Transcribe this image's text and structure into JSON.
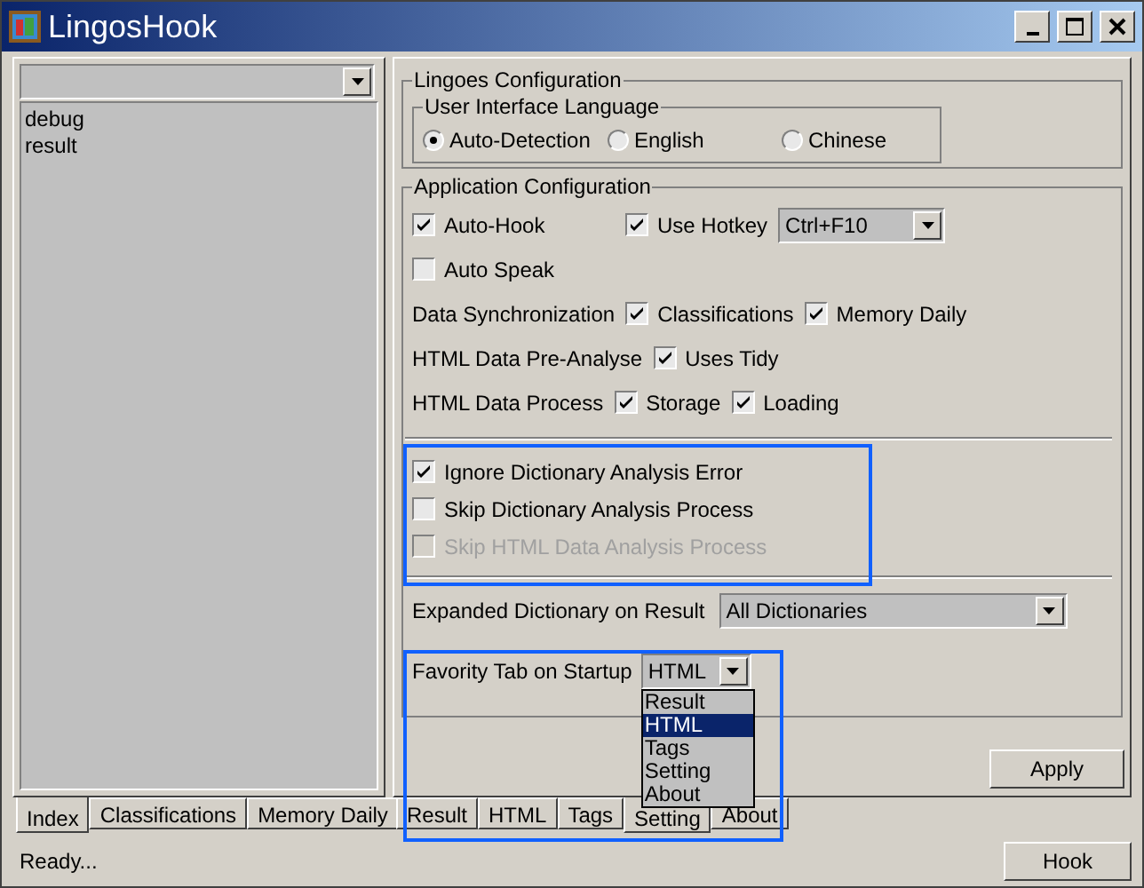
{
  "window": {
    "title": "LingosHook"
  },
  "left": {
    "list": [
      "debug",
      "result"
    ],
    "tabs": [
      {
        "label": "Index",
        "selected": true
      },
      {
        "label": "Classifications",
        "selected": false
      },
      {
        "label": "Memory Daily",
        "selected": false
      }
    ]
  },
  "lingoes_configuration": {
    "title": "Lingoes Configuration",
    "ui_language": {
      "title": "User Interface Language",
      "options": [
        {
          "label": "Auto-Detection",
          "selected": true
        },
        {
          "label": "English",
          "selected": false
        },
        {
          "label": "Chinese",
          "selected": false
        }
      ]
    }
  },
  "application_configuration": {
    "title": "Application Configuration",
    "rows": [
      [
        {
          "kind": "checkbox",
          "label": "Auto-Hook",
          "checked": true
        },
        {
          "kind": "checkbox",
          "label": "Use Hotkey",
          "checked": true
        },
        {
          "kind": "combo",
          "value": "Ctrl+F10"
        }
      ],
      [
        {
          "kind": "checkbox",
          "label": "Auto Speak",
          "checked": false
        }
      ],
      [
        {
          "kind": "label",
          "label": "Data Synchronization"
        },
        {
          "kind": "checkbox",
          "label": "Classifications",
          "checked": true
        },
        {
          "kind": "checkbox",
          "label": "Memory Daily",
          "checked": true
        }
      ],
      [
        {
          "kind": "label",
          "label": "HTML Data Pre-Analyse"
        },
        {
          "kind": "checkbox",
          "label": "Uses Tidy",
          "checked": true
        }
      ],
      [
        {
          "kind": "label",
          "label": "HTML Data Process"
        },
        {
          "kind": "checkbox",
          "label": "Storage",
          "checked": true
        },
        {
          "kind": "checkbox",
          "label": "Loading",
          "checked": true
        }
      ]
    ],
    "analysis": [
      {
        "label": "Ignore Dictionary Analysis Error",
        "checked": true,
        "disabled": false
      },
      {
        "label": "Skip Dictionary Analysis Process",
        "checked": false,
        "disabled": false
      },
      {
        "label": "Skip HTML Data  Analysis Process",
        "checked": false,
        "disabled": true
      }
    ],
    "expanded_dictionary": {
      "label": "Expanded Dictionary on Result",
      "value": "All Dictionaries"
    },
    "favority_tab": {
      "label": "Favority Tab on Startup",
      "value": "HTML",
      "expanded": true,
      "options": [
        {
          "label": "Result",
          "selected": false
        },
        {
          "label": "HTML",
          "selected": true
        },
        {
          "label": "Tags",
          "selected": false
        },
        {
          "label": "Setting",
          "selected": false
        },
        {
          "label": "About",
          "selected": false
        }
      ]
    }
  },
  "apply_button": "Apply",
  "right_tabs": [
    {
      "label": "Result",
      "selected": false
    },
    {
      "label": "HTML",
      "selected": false
    },
    {
      "label": "Tags",
      "selected": false
    },
    {
      "label": "Setting",
      "selected": true
    },
    {
      "label": "About",
      "selected": false
    }
  ],
  "status_bar": {
    "text": "Ready...",
    "button": "Hook"
  }
}
